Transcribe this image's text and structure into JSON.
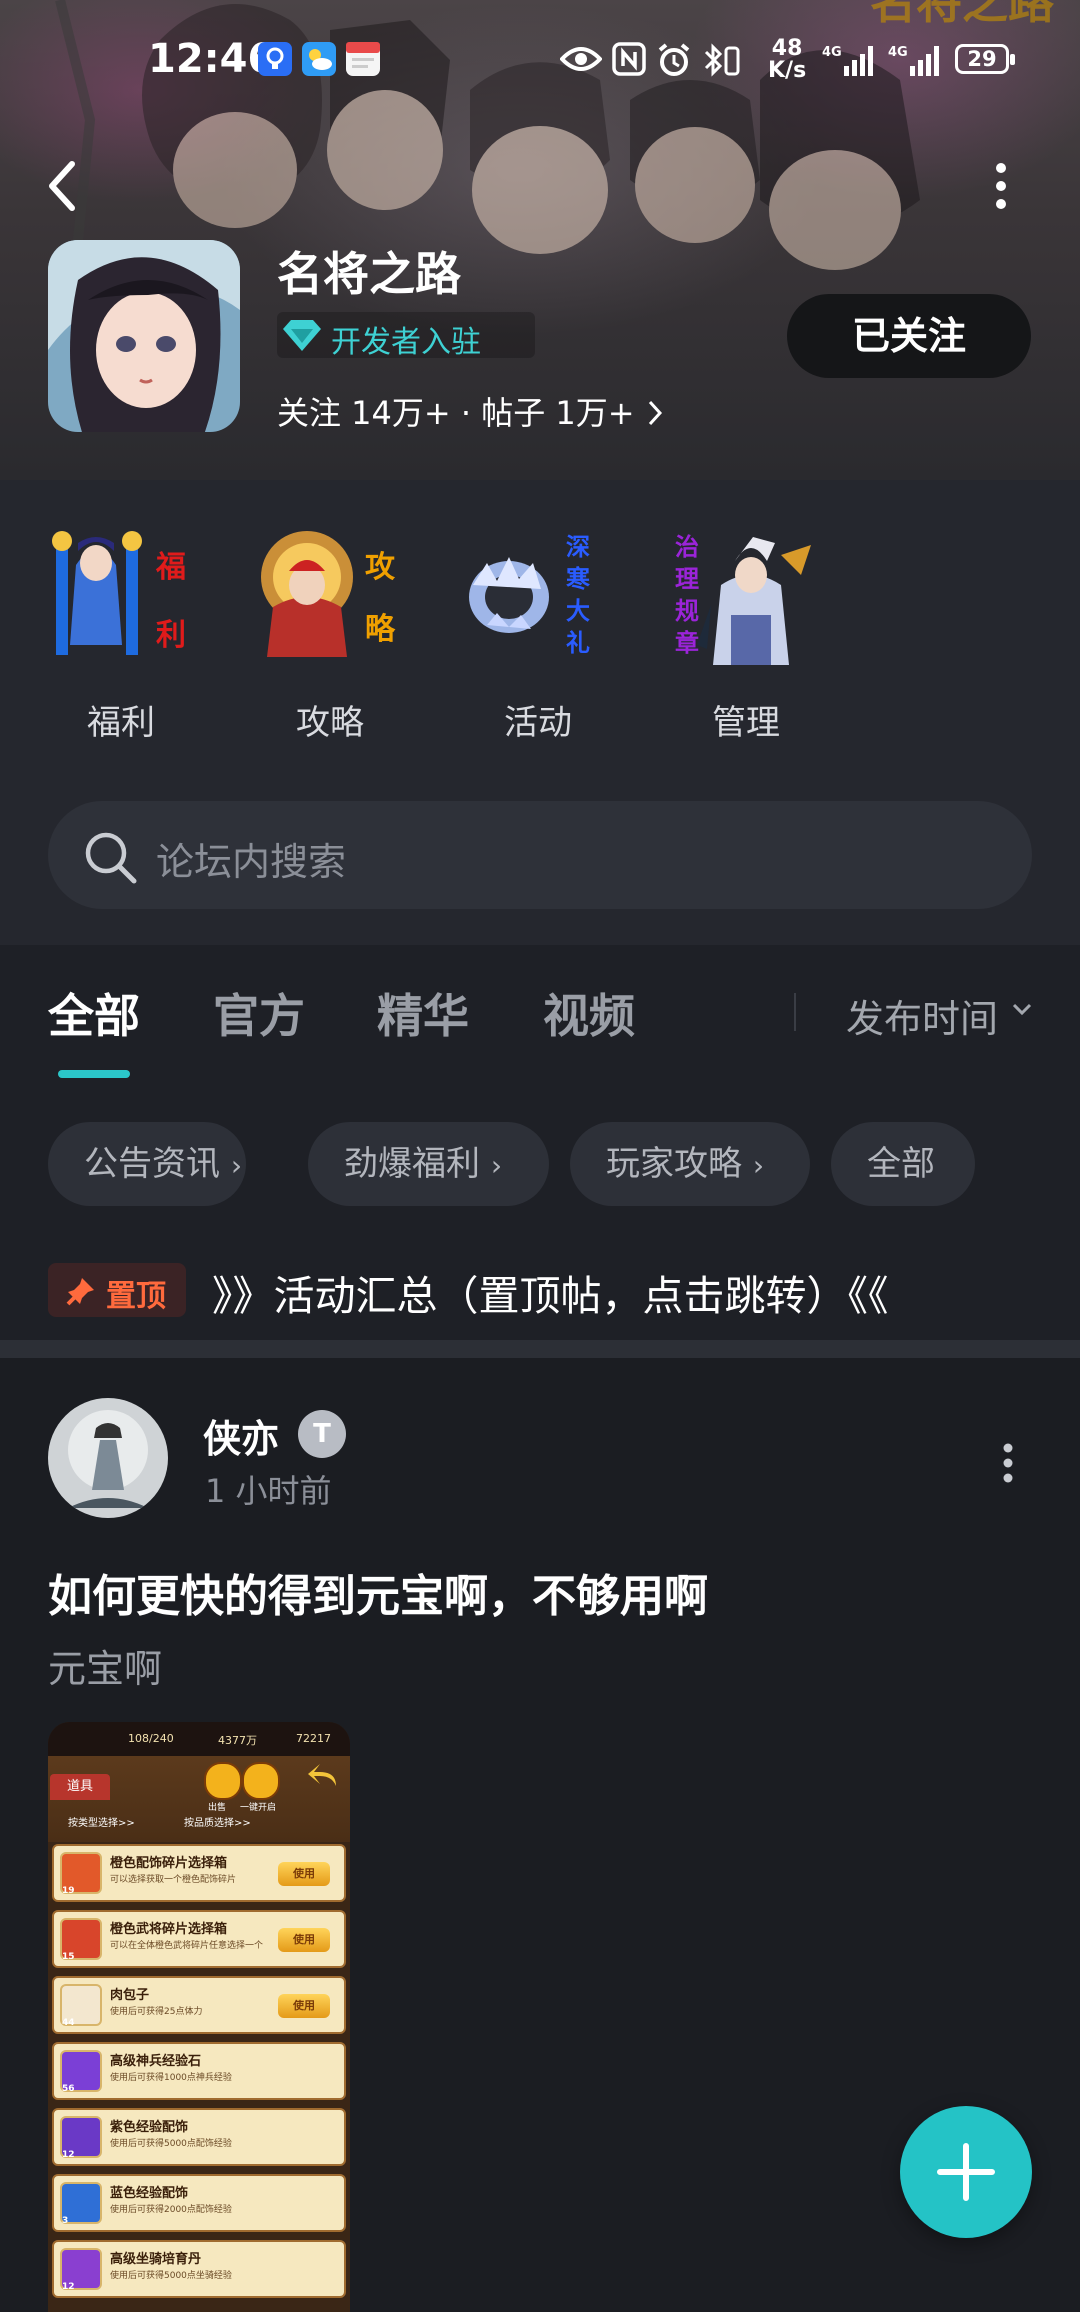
{
  "status_bar": {
    "time": "12:46",
    "net_speed_value": "48",
    "net_speed_unit": "K/s",
    "network_1": "4G",
    "network_2": "4G",
    "battery": "29"
  },
  "header": {
    "game_name": "名将之路",
    "developer_badge": "开发者入驻",
    "stats": "关注 14万+ · 帖子 1万+",
    "follow_button": "已关注"
  },
  "quick_links": [
    {
      "label": "福利",
      "art_text": "福利",
      "art_color": "#e01b1b"
    },
    {
      "label": "攻略",
      "art_text": "攻略",
      "art_color": "#f0a000"
    },
    {
      "label": "活动",
      "art_text": "深寒大礼",
      "art_color": "#2a5cff"
    },
    {
      "label": "管理",
      "art_text": "治理规章",
      "art_color": "#9b24d9"
    }
  ],
  "search": {
    "placeholder": "论坛内搜索"
  },
  "tabs": [
    "全部",
    "官方",
    "精华",
    "视频"
  ],
  "active_tab": "全部",
  "sort_label": "发布时间",
  "chips": [
    "公告资讯",
    "劲爆福利",
    "玩家攻略",
    "全部"
  ],
  "pinned": {
    "badge": "置顶",
    "text": "》》活动汇总（置顶帖，点击跳转）《《"
  },
  "post": {
    "author": "侠亦",
    "level": "T",
    "time": "1 小时前",
    "title": "如何更快的得到元宝啊，不够用啊",
    "body": "元宝啊",
    "screenshot": {
      "stamina": "108/240",
      "coins": "4377万",
      "ingots": "72217",
      "tab": "道具",
      "btn_sell": "出售",
      "btn_open": "一键开启",
      "filter_type": "按类型选择>>",
      "filter_quality": "按品质选择>>",
      "use_label": "使用",
      "items": [
        {
          "name": "橙色配饰碎片选择箱",
          "desc": "可以选择获取一个橙色配饰碎片",
          "count": "19",
          "color": "#e2592a",
          "use": true
        },
        {
          "name": "橙色武将碎片选择箱",
          "desc": "可以在全体橙色武将碎片任意选择一个",
          "count": "15",
          "color": "#d8452b",
          "use": true
        },
        {
          "name": "肉包子",
          "desc": "使用后可获得25点体力",
          "count": "44",
          "color": "#f3e7cf",
          "use": true
        },
        {
          "name": "高级神兵经验石",
          "desc": "使用后可获得1000点神兵经验",
          "count": "56",
          "color": "#7b3fd6",
          "use": false
        },
        {
          "name": "紫色经验配饰",
          "desc": "使用后可获得5000点配饰经验",
          "count": "12",
          "color": "#6a39c6",
          "use": false
        },
        {
          "name": "蓝色经验配饰",
          "desc": "使用后可获得2000点配饰经验",
          "count": "3",
          "color": "#2f6fd6",
          "use": false
        },
        {
          "name": "高级坐骑培育丹",
          "desc": "使用后可获得5000点坐骑经验",
          "count": "12",
          "color": "#8a3fd0",
          "use": false
        }
      ]
    }
  },
  "colors": {
    "accent": "#24c3c6",
    "pin": "#ff6a3d",
    "background": "#1b1d22"
  }
}
